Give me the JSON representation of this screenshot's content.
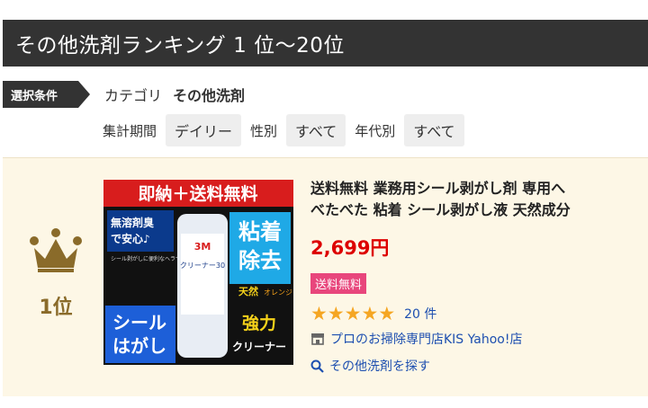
{
  "title": "その他洗剤ランキング 1 位〜20位",
  "filters": {
    "tag": "選択条件",
    "category_label": "カテゴリ",
    "category_value": "その他洗剤",
    "period_label": "集計期間",
    "period_value": "デイリー",
    "gender_label": "性別",
    "gender_value": "すべて",
    "age_label": "年代別",
    "age_value": "すべて"
  },
  "item": {
    "rank": "1位",
    "image": {
      "banner": "即納＋送料無料",
      "line1": "無溶剤臭",
      "line2": "で安心♪",
      "small": "シール剥がしに便利なヘラつき",
      "big1a": "粘着",
      "big1b": "除去",
      "sub": "天然",
      "sub2": "オレンジ",
      "can_brand": "3M",
      "can_name": "クリーナー30",
      "bl1": "シール",
      "bl2": "はがし",
      "br1": "強力",
      "br2": "クリーナー"
    },
    "title_line1": "送料無料 業務用シール剥がし剤 専用へ",
    "title_line2": "べたべた 粘着 シール剥がし液 天然成分",
    "price": "2,699円",
    "badge": "送料無料",
    "rating": 5,
    "review_count": "20 件",
    "shop": "プロのお掃除専門店KIS Yahoo!店",
    "search_link": "その他洗剤を探す",
    "icons": {
      "crown": "crown-icon",
      "shop": "store-icon",
      "search": "search-icon"
    },
    "colors": {
      "price": "#dd0000",
      "badge": "#e8467c",
      "star": "#f5a623",
      "rank": "#8a6b2a"
    }
  }
}
